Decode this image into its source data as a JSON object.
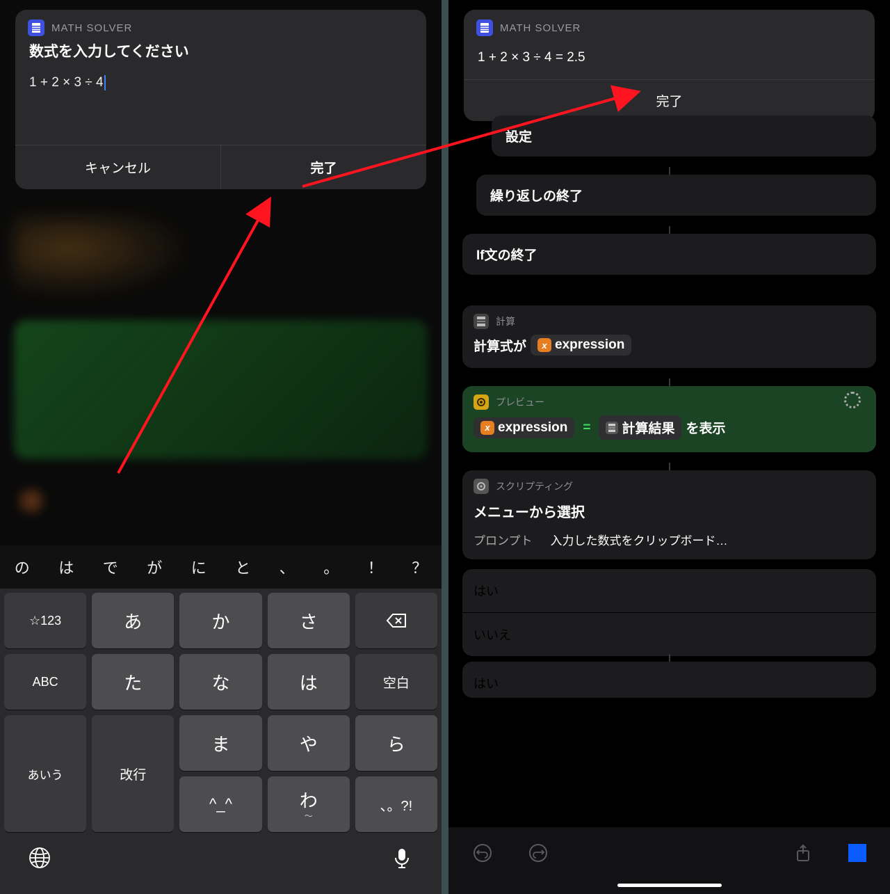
{
  "left": {
    "app_name": "MATH SOLVER",
    "dialog_title": "数式を入力してください",
    "expression_input": "1 + 2 × 3 ÷ 4",
    "cancel_label": "キャンセル",
    "done_label": "完了",
    "candidates": [
      "の",
      "は",
      "で",
      "が",
      "に",
      "と",
      "、",
      "。",
      "！",
      "？"
    ],
    "keys": {
      "star123": "☆123",
      "r1": [
        "あ",
        "か",
        "さ"
      ],
      "backspace": "⌫",
      "abc": "ABC",
      "r2": [
        "た",
        "な",
        "は"
      ],
      "space": "空白",
      "aiu": "あいう",
      "r3": [
        "ま",
        "や",
        "ら"
      ],
      "enter": "改行",
      "r4a": "^_^",
      "r4b": "わ",
      "r4c": "、。?!",
      "r4b_sub": "〜"
    }
  },
  "right": {
    "app_name": "MATH SOLVER",
    "result_text": "1 + 2 × 3 ÷ 4 = 2.5",
    "done_label": "完了",
    "actions": {
      "settei": "設定",
      "repeat_end": "繰り返しの終了",
      "if_end": "If文の終了",
      "calc_header": "計算",
      "calc_line_prefix": "計算式が",
      "expression_var": "expression",
      "preview_header": "プレビュー",
      "preview_equals": "=",
      "calc_result_var": "計算結果",
      "preview_suffix": "を表示",
      "scripting_header": "スクリプティング",
      "menu_title": "メニューから選択",
      "prompt_label": "プロンプト",
      "prompt_value": "入力した数式をクリップボード…",
      "yes": "はい",
      "no": "いいえ",
      "yes2": "はい"
    }
  }
}
